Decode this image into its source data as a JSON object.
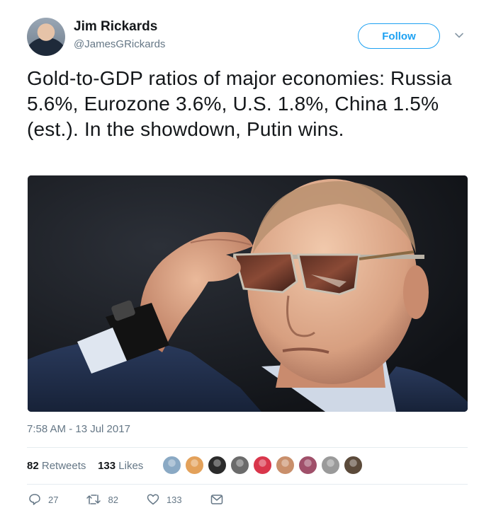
{
  "author": {
    "name": "Jim Rickards",
    "handle": "@JamesGRickards"
  },
  "follow_label": "Follow",
  "tweet_text": "Gold-to-GDP ratios of major economies: Russia 5.6%, Eurozone 3.6%, U.S. 1.8%, China 1.5% (est.). In the showdown, Putin wins.",
  "timestamp": "7:58 AM - 13 Jul 2017",
  "stats": {
    "retweets_count": "82",
    "retweets_label": "Retweets",
    "likes_count": "133",
    "likes_label": "Likes"
  },
  "liker_avatars": [
    {
      "color": "#8aa9c4"
    },
    {
      "color": "#e3a15a"
    },
    {
      "color": "#2b2b2b"
    },
    {
      "color": "#6b6b6b"
    },
    {
      "color": "#d9364b"
    },
    {
      "color": "#c98f6b"
    },
    {
      "color": "#a0506a"
    },
    {
      "color": "#9a9a9a"
    },
    {
      "color": "#5b4a3a"
    }
  ],
  "actions": {
    "reply_count": "27",
    "retweet_count": "82",
    "like_count": "133"
  },
  "colors": {
    "accent": "#1da1f2",
    "secondary_text": "#657786",
    "divider": "#e6ecf0"
  }
}
